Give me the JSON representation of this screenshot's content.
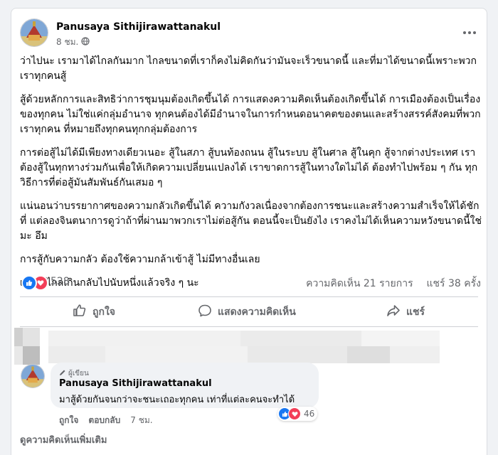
{
  "post": {
    "author": "Panusaya Sithijirawattanakul",
    "time": "8 ชม.",
    "more_icon": "more-horizontal-icon",
    "paragraphs": [
      "ว่าไปนะ เรามาได้ไกลกันมาก ไกลขนาดที่เราก็คงไม่คิดกันว่ามันจะเร็วขนาดนี้ และที่มาได้ขนาดนี้เพราะพวกเราทุกคนสู้",
      "สู้ด้วยหลักการและสิทธิว่าการชุมนุมต้องเกิดขึ้นได้ การแสดงความคิดเห็นต้องเกิดขึ้นได้ การเมืองต้องเป็นเรื่องของทุกคน ไม่ใช่แค่กลุ่มอำนาจ ทุกคนต้องได้มีอำนาจในการกำหนดอนาคตของตนและสร้างสรรค์สังคมที่พวกเราทุกคน ที่หมายถึงทุกคนทุกกลุ่มต้องการ",
      "การต่อสู้ไม่ได้มีเพียงทางเดียวเนอะ สู้ในสภา สู้บนท้องถนน สู้ในระบบ สู้ในศาล สู้ในคุก สู้จากต่างประเทศ เราต้องสู้ในทุกทางร่วมกันเพื่อให้เกิดความเปลี่ยนแปลงได้ เราขาดการสู้ในทางใดไม่ได้ ต้องทำไปพร้อม ๆ กัน ทุกวิธีการที่ต่อสู้มันสัมพันธ์กันเสมอ ๆ",
      "แน่นอนว่าบรรยากาศของความกลัวเกิดขึ้นได้ ความกังวลเนื่องจากต้องการชนะและสร้างความสำเร็จให้ได้ชักที่ แต่ลองจินตนาการดูว่าถ้าที่ผ่านมาพวกเราไม่ต่อสู้กัน ตอนนี้จะเป็นยังไง เราคงไม่ได้เห็นความหวังขนาดนี้ใช่มะ อึม",
      "การสู้กับความกลัว ต้องใช้ความกล้าเข้าสู้ ไม่มีทางอื่นเลย",
      "เรามาไกลเกินกลับไปนับหนึ่งแล้วจริง ๆ นะ"
    ],
    "reactions": {
      "count": "528",
      "icons": [
        "like-icon",
        "love-icon"
      ]
    },
    "comments_count": "ความคิดเห็น 21 รายการ",
    "shares_count": "แชร์ 38 ครั้ง",
    "actions": {
      "like": "ถูกใจ",
      "comment": "แสดงความคิดเห็น",
      "share": "แชร์"
    }
  },
  "comment": {
    "badge": "ผู้เขียน",
    "author": "Panusaya Sithijirawattanakul",
    "text": "มาสู้ด้วยกันจนกว่าจะชนะเถอะทุกคน เท่าที่แต่ละคนจะทำได้",
    "reaction_count": "46",
    "actions": {
      "like": "ถูกใจ",
      "reply": "ตอบกลับ",
      "time": "7 ชม."
    }
  },
  "more_comments": "ดูความคิดเห็นเพิ่มเติม",
  "colors": {
    "like_blue": "#1877f2",
    "love_red": "#f33e58",
    "muted": "#65676b"
  }
}
